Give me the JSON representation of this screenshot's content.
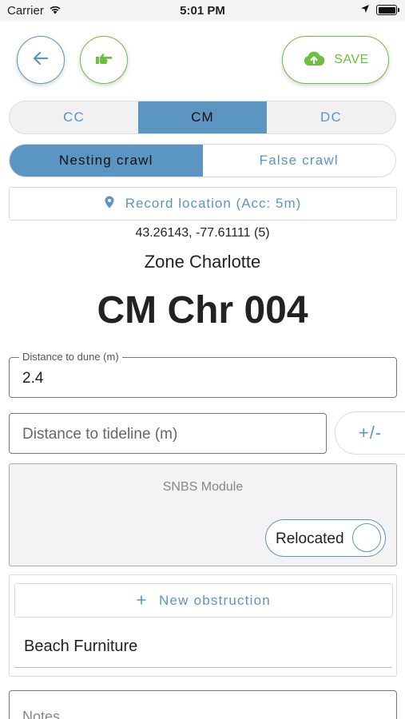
{
  "status_bar": {
    "carrier": "Carrier",
    "time": "5:01 PM"
  },
  "toolbar": {
    "save_label": "SAVE"
  },
  "beach_segments": {
    "options": [
      "CC",
      "CM",
      "DC"
    ],
    "selected": "CM"
  },
  "crawl_type": {
    "options": [
      "Nesting crawl",
      "False crawl"
    ],
    "selected": "Nesting crawl"
  },
  "location": {
    "button_label": "Record location (Acc: 5m)",
    "coordinates": "43.26143, -77.61111 (5)"
  },
  "zone": "Zone Charlotte",
  "record_title": "CM Chr 004",
  "distance_to_dune": {
    "label": "Distance to dune (m)",
    "value": "2.4"
  },
  "distance_to_tideline": {
    "placeholder": "Distance to tideline (m)",
    "toggle_label": "+/-"
  },
  "snbs_module": {
    "title": "SNBS Module",
    "relocated_label": "Relocated",
    "relocated": false
  },
  "obstructions": {
    "new_button": "New obstruction",
    "items": [
      "Beach Furniture"
    ]
  },
  "notes": {
    "placeholder": "Notes"
  },
  "colors": {
    "accent_blue": "#5b95c2",
    "accent_green": "#6cc040"
  }
}
